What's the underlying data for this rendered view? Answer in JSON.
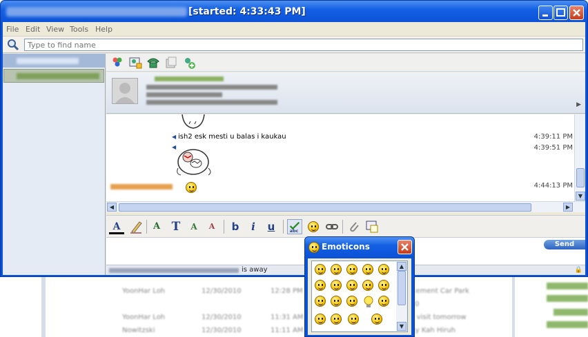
{
  "window": {
    "title": "[started: 4:33:43 PM]"
  },
  "menu": [
    "File",
    "Edit",
    "View",
    "Tools",
    "Help"
  ],
  "search": {
    "placeholder": "Type to find name"
  },
  "chat": {
    "messages": [
      {
        "text": "ish2 esk mesti u balas i kaukau",
        "time": "4:39:11 PM"
      },
      {
        "text": "",
        "time": "4:39:51 PM"
      },
      {
        "text": "",
        "time": "4:44:13 PM"
      }
    ]
  },
  "send_label": "Send",
  "status": {
    "text": "is away"
  },
  "emoticons": {
    "title": "Emoticons",
    "icon_names": [
      "smile-icon",
      "laugh-icon",
      "wink-icon",
      "grin-icon",
      "cool-icon",
      "surprised-icon",
      "angry-icon",
      "sad-icon",
      "worried-icon",
      "confused-icon",
      "tongue-icon",
      "shocked-icon",
      "thinking-icon",
      "idea-icon",
      "check-smile-icon",
      "blocked-smile-icon",
      "smirk-icon",
      "crying-icon",
      "rofl-icon"
    ]
  },
  "icons": [
    "search-icon",
    "contacts-icon",
    "add-contact-icon",
    "phone-icon",
    "files-icon",
    "invite-icon",
    "font-color-icon",
    "highlight-icon",
    "font-icon",
    "text-icon",
    "grow-text-icon",
    "shrink-text-icon",
    "bold-icon",
    "italic-icon",
    "underline-icon",
    "spellcheck-icon",
    "emoticon-icon",
    "link-icon",
    "attach-icon",
    "screenshot-icon",
    "lock-icon"
  ],
  "colors": {
    "titlebar": "#0c52d6",
    "accent": "#2d64c0"
  }
}
